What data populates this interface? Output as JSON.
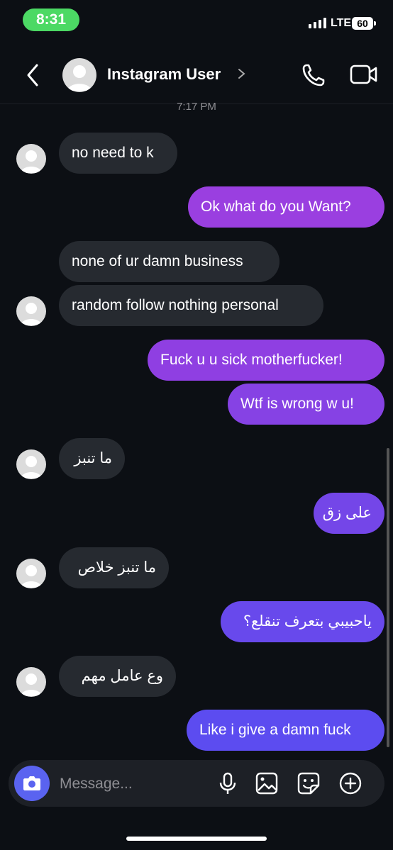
{
  "status": {
    "time": "8:31",
    "network": "LTE",
    "battery": "60"
  },
  "header": {
    "title": "Instagram User"
  },
  "thread": {
    "timestamp": "7:17 PM",
    "messages": [
      {
        "dir": "in",
        "text": "no need to k"
      },
      {
        "dir": "out",
        "text": "Ok what do you Want?"
      },
      {
        "dir": "in",
        "text": "none of ur damn business"
      },
      {
        "dir": "in",
        "text": "random follow nothing personal"
      },
      {
        "dir": "out",
        "text": "Fuck u u sick motherfucker!"
      },
      {
        "dir": "out",
        "text": "Wtf is wrong w u!"
      },
      {
        "dir": "in",
        "text": "ما تنبز"
      },
      {
        "dir": "out",
        "text": "على زق"
      },
      {
        "dir": "in",
        "text": "ما تنبز خلاص"
      },
      {
        "dir": "out",
        "text": "ياحبيبي بتعرف تنقلع؟"
      },
      {
        "dir": "in",
        "text": "وع  عامل مهم"
      },
      {
        "dir": "out",
        "text": "Like i give a damn fuck"
      }
    ]
  },
  "composer": {
    "placeholder": "Message..."
  },
  "icons": {
    "camera": "camera-icon",
    "mic": "microphone-icon",
    "gallery": "image-icon",
    "sticker": "sticker-icon",
    "plus": "plus-circle-icon",
    "back": "back-arrow-icon",
    "call": "phone-icon",
    "video": "video-camera-icon"
  },
  "colors": {
    "background": "#0c0f14",
    "incoming": "#262a30",
    "outgoing_top": "#9b3ee0",
    "outgoing_bottom": "#5b4cf0",
    "camera": "#5a63f0"
  }
}
